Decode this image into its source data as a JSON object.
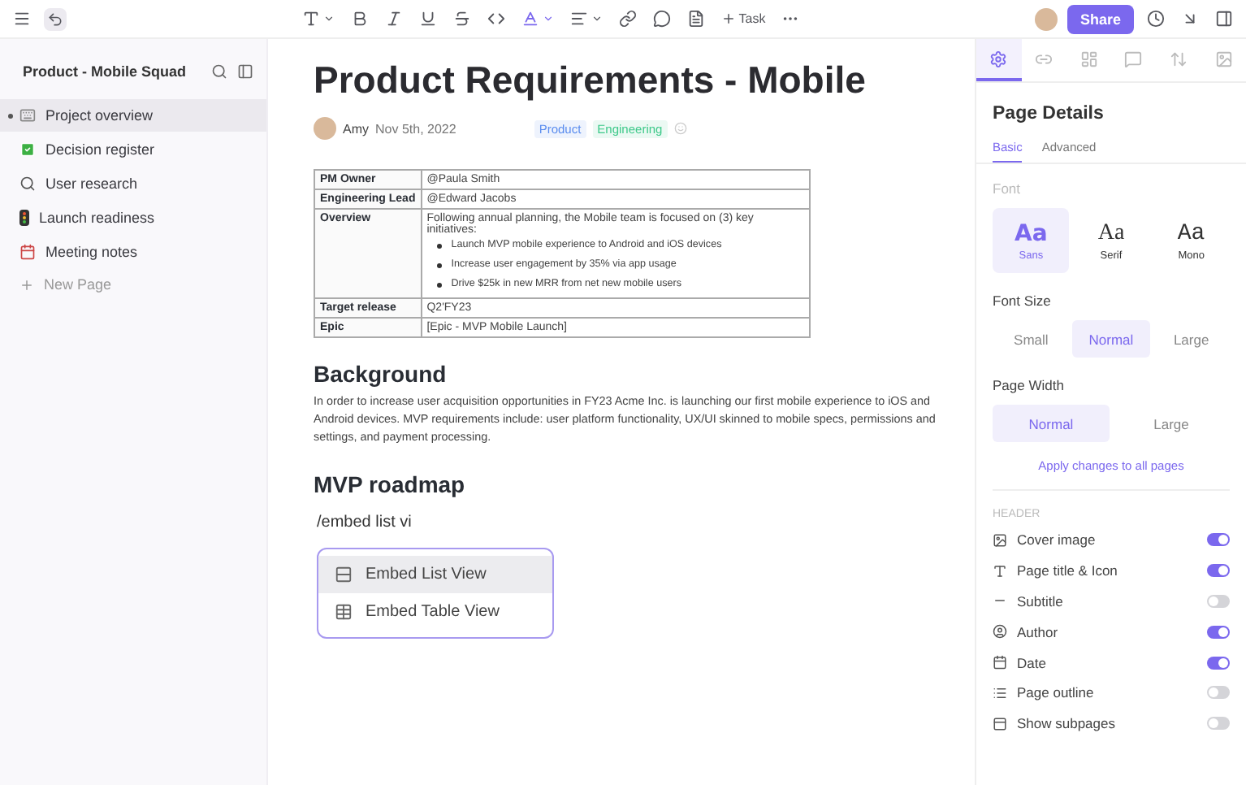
{
  "toolbar": {
    "task": "Task",
    "share": "Share"
  },
  "sidebar": {
    "title": "Product - Mobile Squad",
    "items": [
      {
        "label": "Project overview",
        "selected": true
      },
      {
        "label": "Decision register",
        "selected": false
      },
      {
        "label": "User research",
        "selected": false
      },
      {
        "label": "Launch readiness",
        "selected": false
      },
      {
        "label": "Meeting notes",
        "selected": false
      }
    ],
    "new_page": "New Page"
  },
  "doc": {
    "title": "Product Requirements - Mobile",
    "author": "Amy",
    "date": "Nov 5th, 2022",
    "tags": [
      {
        "label": "Product",
        "color": "#5b8def"
      },
      {
        "label": "Engineering",
        "color": "#3ec98a"
      }
    ],
    "table": [
      {
        "label": "PM Owner",
        "value": "@Paula Smith"
      },
      {
        "label": "Engineering Lead",
        "value": "@Edward Jacobs"
      },
      {
        "label": "Overview",
        "value": "Following annual planning, the Mobile team is focused on (3) key initiatives:",
        "bullets": [
          "Launch MVP mobile experience to Android and iOS devices",
          "Increase user engagement by 35% via app usage",
          "Drive $25k in new MRR from net new mobile users"
        ]
      },
      {
        "label": "Target release",
        "value": "Q2'FY23"
      },
      {
        "label": "Epic",
        "value": "[Epic - MVP Mobile Launch]"
      }
    ],
    "background_heading": "Background",
    "background_text": "In order to increase user acquisition opportunities in FY23 Acme Inc. is launching our first mobile experience to iOS and Android devices. MVP requirements include: user platform functionality, UX/UI skinned to mobile specs, permissions and settings, and payment processing.",
    "roadmap_heading": "MVP roadmap",
    "command": "/embed list vi",
    "menu": [
      {
        "label": "Embed List View",
        "selected": true
      },
      {
        "label": "Embed Table View",
        "selected": false
      }
    ]
  },
  "panel": {
    "tabs": [
      {
        "selected": true
      },
      {
        "selected": false
      },
      {
        "selected": false
      },
      {
        "selected": false
      },
      {
        "selected": false
      },
      {
        "selected": false
      }
    ],
    "title": "Page Details",
    "subtabs": [
      {
        "label": "Basic",
        "selected": true
      },
      {
        "label": "Advanced",
        "selected": false
      }
    ],
    "font_label": "Font",
    "fonts": [
      {
        "sample": "Aa",
        "label": "Sans",
        "kind": "sans",
        "selected": true
      },
      {
        "sample": "Aa",
        "label": "Serif",
        "kind": "serif",
        "selected": false
      },
      {
        "sample": "Aa",
        "label": "Mono",
        "kind": "mono",
        "selected": false
      }
    ],
    "size_label": "Font Size",
    "sizes": [
      {
        "label": "Small",
        "selected": false
      },
      {
        "label": "Normal",
        "selected": true
      },
      {
        "label": "Large",
        "selected": false
      }
    ],
    "width_label": "Page Width",
    "widths": [
      {
        "label": "Normal",
        "selected": true
      },
      {
        "label": "Large",
        "selected": false
      }
    ],
    "apply": "Apply changes to all pages",
    "header_label": "HEADER",
    "toggles": [
      {
        "label": "Cover image",
        "on": true
      },
      {
        "label": "Page title & Icon",
        "on": true
      },
      {
        "label": "Subtitle",
        "on": false
      },
      {
        "label": "Author",
        "on": true
      },
      {
        "label": "Date",
        "on": true
      },
      {
        "label": "Page outline",
        "on": false
      },
      {
        "label": "Show subpages",
        "on": false
      }
    ]
  }
}
